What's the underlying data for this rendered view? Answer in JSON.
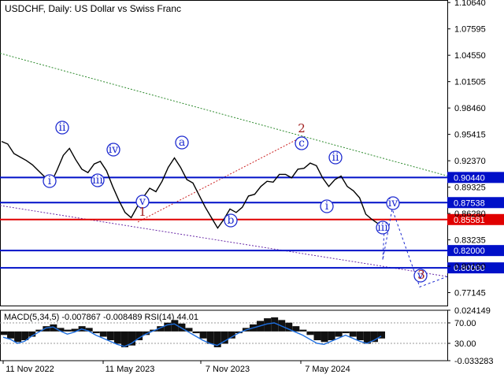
{
  "header": {
    "symbol": "USDCHF",
    "timeframe": "Daily",
    "description": "US Dollar vs Swiss Franc",
    "title": "USDCHF, Daily:  US Dollar vs Swiss Franc"
  },
  "chart_data": {
    "type": "line",
    "title": "USDCHF, Daily:  US Dollar vs Swiss Franc",
    "ylim": [
      0.7565,
      1.1093
    ],
    "y_ticks": [
      "1.10640",
      "1.07595",
      "1.04550",
      "1.01505",
      "0.98460",
      "0.95415",
      "0.92370",
      "0.89325",
      "0.86280",
      "0.83235",
      "0.80190",
      "0.77145"
    ],
    "x_ticks": [
      "11 Nov 2022",
      "11 May 2023",
      "7 Nov 2023",
      "7 May 2024"
    ],
    "colors": {
      "price": "#000000",
      "level": "#0010c8",
      "current_level": "#e00000",
      "wave_label": "#1e2bd0",
      "major_label": "#a01c1c",
      "trend_line": "#2e8b2e"
    },
    "series": [
      {
        "values": [
          0.946,
          0.943,
          0.932,
          0.928,
          0.924,
          0.919,
          0.912,
          0.905,
          0.898,
          0.913,
          0.93,
          0.938,
          0.925,
          0.914,
          0.91,
          0.92,
          0.923,
          0.912,
          0.894,
          0.878,
          0.864,
          0.858,
          0.871,
          0.882,
          0.892,
          0.888,
          0.9,
          0.916,
          0.927,
          0.916,
          0.902,
          0.898,
          0.884,
          0.87,
          0.858,
          0.846,
          0.856,
          0.868,
          0.864,
          0.87,
          0.883,
          0.885,
          0.894,
          0.9,
          0.899,
          0.908,
          0.908,
          0.904,
          0.914,
          0.915,
          0.921,
          0.918,
          0.904,
          0.894,
          0.902,
          0.906,
          0.894,
          0.889,
          0.881,
          0.862,
          0.856,
          0.851,
          0.845
        ]
      }
    ],
    "levels": [
      {
        "label": "0.90440",
        "value": 0.9044,
        "kind": "support_resistance"
      },
      {
        "label": "0.87538",
        "value": 0.87538,
        "kind": "support_resistance"
      },
      {
        "label": "0.85581",
        "value": 0.85581,
        "kind": "current"
      },
      {
        "label": "0.82000",
        "value": 0.82,
        "kind": "support_resistance"
      },
      {
        "label": "0.80000",
        "value": 0.8,
        "kind": "support_resistance"
      }
    ],
    "wave_labels": [
      {
        "text": "i",
        "style": "minor"
      },
      {
        "text": "ii",
        "style": "minor"
      },
      {
        "text": "iii",
        "style": "minor"
      },
      {
        "text": "iv",
        "style": "minor"
      },
      {
        "text": "v",
        "style": "minor"
      },
      {
        "text": "1",
        "style": "major"
      },
      {
        "text": "a",
        "style": "minor"
      },
      {
        "text": "b",
        "style": "minor"
      },
      {
        "text": "c",
        "style": "minor"
      },
      {
        "text": "2",
        "style": "major"
      },
      {
        "text": "i",
        "style": "minor"
      },
      {
        "text": "ii",
        "style": "minor"
      },
      {
        "text": "iii",
        "style": "minor"
      },
      {
        "text": "iv",
        "style": "minor"
      },
      {
        "text": "v",
        "style": "minor"
      },
      {
        "text": "3",
        "style": "major"
      }
    ]
  },
  "indicator": {
    "label": "MACD(5,34,5) -0.007867 -0.008489 RSI(14) 44.01",
    "ylim": [
      -0.0333,
      0.0241
    ],
    "y_ticks": [
      "0.024149",
      "70.00",
      "30.00",
      "-0.033283"
    ],
    "macd_values": [
      -0.004,
      -0.008,
      -0.012,
      -0.01,
      -0.006,
      0.002,
      0.006,
      0.008,
      0.004,
      0.002,
      0.003,
      0.006,
      0.004,
      -0.002,
      -0.006,
      -0.01,
      -0.014,
      -0.018,
      -0.016,
      -0.01,
      -0.004,
      0.002,
      0.006,
      0.01,
      0.013,
      0.009,
      0.004,
      -0.002,
      -0.008,
      -0.014,
      -0.018,
      -0.014,
      -0.008,
      -0.002,
      0.004,
      0.008,
      0.012,
      0.015,
      0.016,
      0.013,
      0.01,
      0.006,
      0.002,
      -0.004,
      -0.01,
      -0.012,
      -0.01,
      -0.006,
      -0.002,
      -0.006,
      -0.01,
      -0.014,
      -0.012,
      -0.008
    ],
    "rsi_values": [
      42,
      38,
      30,
      34,
      44,
      52,
      60,
      62,
      54,
      48,
      52,
      58,
      54,
      46,
      40,
      34,
      28,
      24,
      30,
      40,
      48,
      54,
      60,
      66,
      68,
      60,
      52,
      44,
      36,
      30,
      26,
      34,
      42,
      50,
      56,
      60,
      64,
      68,
      70,
      64,
      58,
      52,
      46,
      38,
      30,
      28,
      34,
      40,
      46,
      40,
      34,
      30,
      36,
      44
    ]
  }
}
